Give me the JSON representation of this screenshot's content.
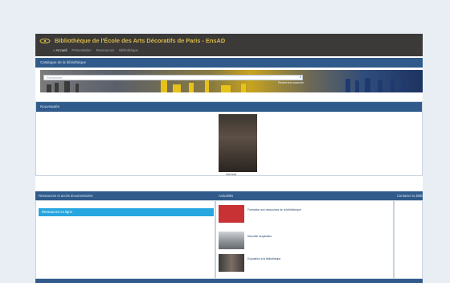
{
  "header": {
    "site_title": "Bibliothèque de l'École des Arts Décoratifs de Paris - EnsAD",
    "nav": [
      "Accueil",
      "Présentation",
      "Ressources",
      "Bibliothèque"
    ]
  },
  "catalogue": {
    "title": "Catalogue de la bibliothèque",
    "search_placeholder": "Rechercher",
    "advanced_search": "Recherche avancée"
  },
  "nouveautes": {
    "title": "Nouveautés",
    "caption": "Voir tout"
  },
  "ressources": {
    "title": "Ressources et accès documentaires",
    "item": "Ressources en ligne"
  },
  "actualites": {
    "title": "Actualités",
    "items": [
      "Formation aux ressources de la bibliothèque",
      "Nouvelle acquisition",
      "Exposition à la bibliothèque"
    ]
  },
  "contact": {
    "title": "Contacter la bibliothèque"
  },
  "colors": {
    "header_bg": "#3b3a38",
    "title_gold": "#d9b84a",
    "section_blue": "#2f5a8a",
    "highlight_blue": "#27a6df"
  }
}
